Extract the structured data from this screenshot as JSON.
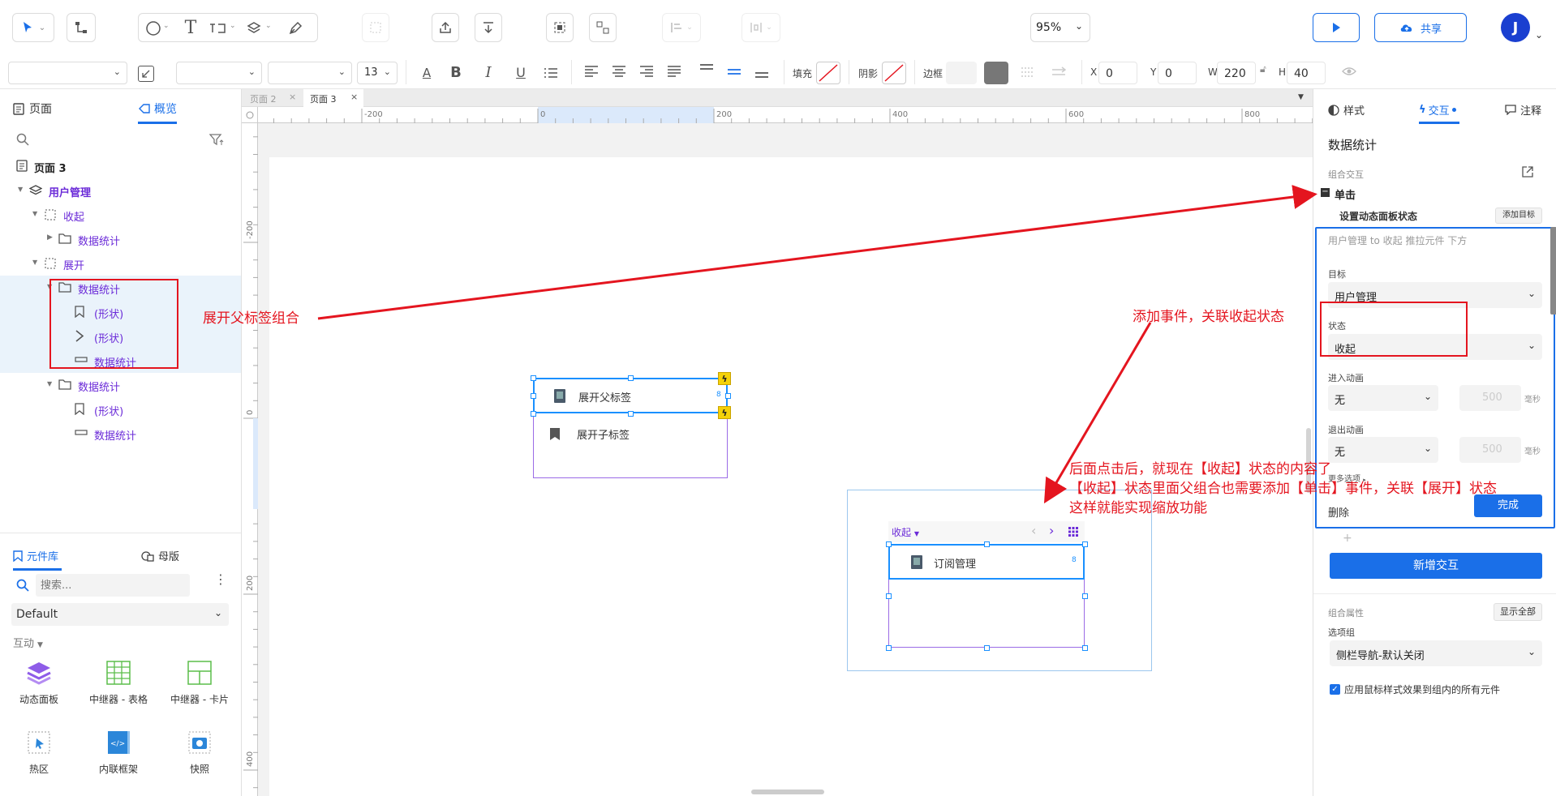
{
  "toolbar": {
    "zoom": "95%",
    "share_label": "共享",
    "avatar_initial": "J",
    "font_size": "13",
    "fill_label": "填充",
    "shadow_label": "阴影",
    "border_label": "边框",
    "x_label": "X",
    "x_value": "0",
    "y_label": "Y",
    "y_value": "0",
    "w_label": "W",
    "w_value": "220",
    "h_label": "H",
    "h_value": "40"
  },
  "left_panel": {
    "tabs": [
      "页面",
      "概览"
    ],
    "tree": [
      {
        "label": "页面 3",
        "indent": 0,
        "icon": "page-icon",
        "bold": true
      },
      {
        "label": "用户管理",
        "indent": 1,
        "icon": "layers-icon",
        "bold": true
      },
      {
        "label": "收起",
        "indent": 2,
        "icon": "dashed-box-icon"
      },
      {
        "label": "数据统计",
        "indent": 3,
        "icon": "folder-icon"
      },
      {
        "label": "展开",
        "indent": 2,
        "icon": "dashed-box-icon"
      },
      {
        "label": "数据统计",
        "indent": 3,
        "icon": "folder-icon",
        "highlight": true
      },
      {
        "label": "(形状)",
        "indent": 4,
        "icon": "bookmark-icon",
        "highlight": true
      },
      {
        "label": "(形状)",
        "indent": 4,
        "icon": "chevron-shape-icon",
        "highlight": true
      },
      {
        "label": "数据统计",
        "indent": 4,
        "icon": "rect-icon",
        "highlight": true
      },
      {
        "label": "数据统计",
        "indent": 3,
        "icon": "folder-icon"
      },
      {
        "label": "(形状)",
        "indent": 4,
        "icon": "bookmark-icon"
      },
      {
        "label": "数据统计",
        "indent": 4,
        "icon": "rect-icon"
      }
    ],
    "library_tabs": [
      "元件库",
      "母版"
    ],
    "search_placeholder": "搜索...",
    "library_select": "Default",
    "section_label": "互动",
    "widgets": [
      {
        "label": "动态面板",
        "icon": "dynamic-panel-icon"
      },
      {
        "label": "中继器 - 表格",
        "icon": "repeater-table-icon"
      },
      {
        "label": "中继器 - 卡片",
        "icon": "repeater-card-icon"
      },
      {
        "label": "热区",
        "icon": "hotspot-icon"
      },
      {
        "label": "内联框架",
        "icon": "inline-frame-icon"
      },
      {
        "label": "快照",
        "icon": "snapshot-icon"
      }
    ]
  },
  "canvas": {
    "tabs": [
      "页面 2",
      "页面 3"
    ],
    "ruler_top": [
      "-200",
      "0",
      "200",
      "400",
      "600",
      "800"
    ],
    "ruler_left": [
      "-200",
      "0",
      "200",
      "400"
    ],
    "widget_parent_label": "展开父标签",
    "widget_child_label": "展开子标签",
    "preview_state": "收起",
    "preview_item": "订阅管理",
    "annotations": [
      "展开父标签组合",
      "添加事件，关联收起状态",
      "后面点击后，就现在【收起】状态的内容了",
      "【收起】状态里面父组合也需要添加【单击】事件，关联【展开】状态",
      "这样就能实现缩放功能"
    ]
  },
  "right_panel": {
    "tabs": [
      "样式",
      "交互",
      "注释"
    ],
    "title": "数据统计",
    "group_interaction": "组合交互",
    "event": "单击",
    "action": "设置动态面板状态",
    "add_target": "添加目标",
    "summary": "用户管理 to 收起 推拉元件 下方",
    "target_label": "目标",
    "target_value": "用户管理",
    "state_label": "状态",
    "state_value": "收起",
    "enter_anim_label": "进入动画",
    "enter_anim_value": "无",
    "enter_ms_placeholder": "500",
    "ms_unit": "毫秒",
    "exit_anim_label": "退出动画",
    "exit_anim_value": "无",
    "exit_ms_placeholder": "500",
    "more_options": "更多选项",
    "delete": "删除",
    "done": "完成",
    "add_interaction": "新增交互",
    "group_props": "组合属性",
    "show_all": "显示全部",
    "option_group_label": "选项组",
    "option_group_value": "侧栏导航-默认关闭",
    "checkbox_label": "应用鼠标样式效果到组内的所有元件"
  },
  "colors": {
    "accent": "#1a6fe8",
    "purple": "#6b2bd8",
    "annotation": "#e4151f"
  }
}
